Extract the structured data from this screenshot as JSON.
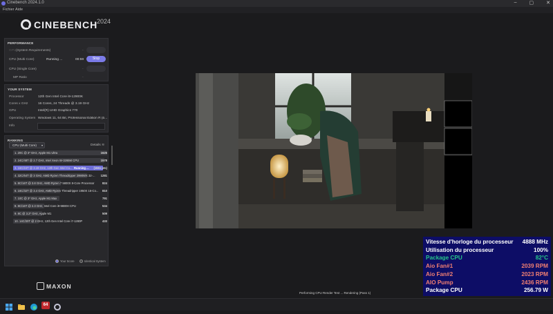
{
  "window": {
    "title": "Cinebench 2024.1.0"
  },
  "menu": [
    "Fichier",
    "Aide"
  ],
  "logo": {
    "name": "CINEBENCH",
    "year": "2024"
  },
  "performance": {
    "header": "PERFORMANCE",
    "requirements_label": "(System Requirements)",
    "gpu_label": "GPU",
    "multi_label": "CPU (Multi Core)",
    "multi_status": "Running ...",
    "multi_time": "00:59",
    "stop_label": "Stop",
    "single_label": "CPU (Single Core)",
    "mp_label": "MP Ratio",
    "dash": "-"
  },
  "system": {
    "header": "YOUR SYSTEM",
    "rows": [
      {
        "k": "Processor",
        "v": "12th Gen Intel Core i9-12900K"
      },
      {
        "k": "Cores x GHz",
        "v": "16 Cores, 24 Threads @ 3.19 GHz"
      },
      {
        "k": "GPU",
        "v": "Intel(R) UHD Graphics 770"
      },
      {
        "k": "Operating System",
        "v": "Windows 11, 64 Bit, Professional Edition R (b..."
      },
      {
        "k": "Info",
        "v": ""
      }
    ]
  },
  "ranking": {
    "header": "RANKING",
    "select": "CPU (Multi Core)",
    "details": "Details",
    "rows": [
      {
        "label": "1. 20C @ 3* GHz, Apple M1 Ultra",
        "score": "1625",
        "fill": 1.0
      },
      {
        "label": "2. 24C/48T @ 2.7 GHz, Intel Xeon W-3265M CPU",
        "score": "1578",
        "fill": 0.97
      },
      {
        "label": "3. 16C/24T @ 3.19 GHz, 12th Gen Intel Co...",
        "status": "Running ...",
        "score": "(1551 pts)",
        "fill": 0.955,
        "active": true
      },
      {
        "label": "4. 32C/64T @ 3 GHz, AMD Ryzen Threadripper 2990WX 32-...",
        "score": "1281",
        "fill": 0.79
      },
      {
        "label": "5. 8C/16T @ 3.8 GHz, AMD Ryzen 7 5800X 8-Core Processor",
        "score": "824",
        "fill": 0.51
      },
      {
        "label": "6. 16C/32T @ 3.4 GHz, AMD Ryzen Threadripper 1950X 16-Co...",
        "score": "810",
        "fill": 0.5
      },
      {
        "label": "7. 10C @ 3* GHz, Apple M1 Max",
        "score": "791",
        "fill": 0.49
      },
      {
        "label": "8. 8C/16T @ 2.3 GHz, Intel Core i9-9880H CPU",
        "score": "534",
        "fill": 0.33
      },
      {
        "label": "9. 8C @ 3.2* GHz, Apple M1",
        "score": "509",
        "fill": 0.31
      },
      {
        "label": "10. 14C/20T @ 2 GHz, 12th Gen Intel Core i7-1280P",
        "score": "433",
        "fill": 0.27
      }
    ],
    "legend_score": "Your Score",
    "legend_identical": "Identical System"
  },
  "brand": "MAXON",
  "status": "Performing CPU Render Test ... Rendering (Pass 1)",
  "hwmon": [
    {
      "k": "Vitesse d'horloge du processeur",
      "v": "4888 MHz",
      "color": "#ffffff"
    },
    {
      "k": "Utilisation du processeur",
      "v": "100%",
      "color": "#ffffff"
    },
    {
      "k": "Package CPU",
      "v": "82°C",
      "color": "#27c48a"
    },
    {
      "k": "Aio Fan#1",
      "v": "2039 RPM",
      "color": "#f07f72"
    },
    {
      "k": "Aio Fan#2",
      "v": "2023 RPM",
      "color": "#f07f72"
    },
    {
      "k": "AIO Pump",
      "v": "2436 RPM",
      "color": "#f07f72"
    },
    {
      "k": "Package CPU",
      "v": "256.79 W",
      "color": "#ffffff"
    }
  ],
  "taskbar": {
    "badge": "64"
  }
}
